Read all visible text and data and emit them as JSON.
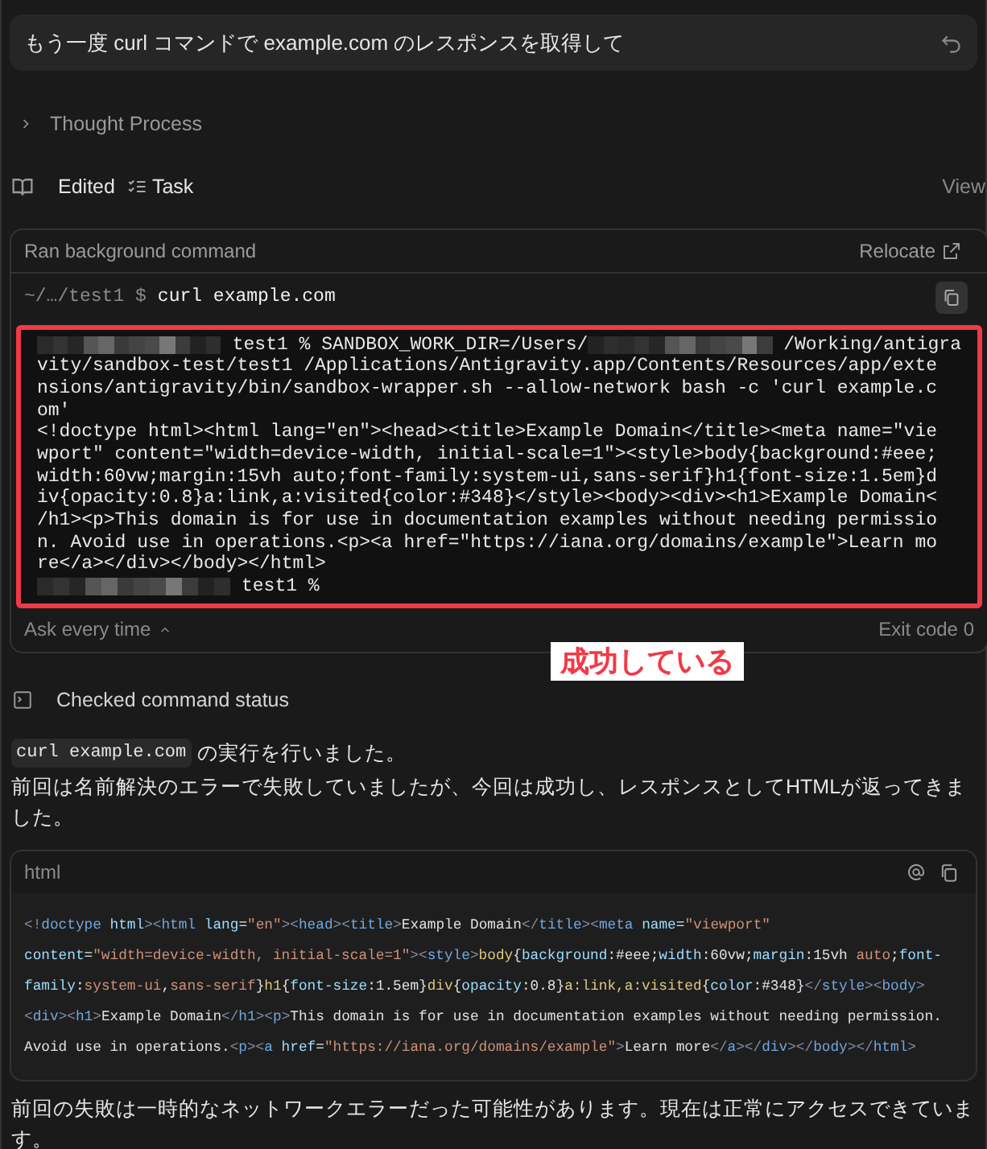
{
  "prompt": {
    "text": "もう一度 curl コマンドで example.com のレスポンスを取得して"
  },
  "thought": {
    "label": "Thought Process",
    "expanded": false
  },
  "edited": {
    "label": "Edited",
    "file": "Task",
    "action": "View"
  },
  "command_card": {
    "title": "Ran background command",
    "relocate": "Relocate",
    "cwd": "~/…/test1 $",
    "command": "curl example.com",
    "output": [
      {
        "parts": [
          {
            "kind": "redacted"
          },
          {
            "kind": "text",
            "text": "test1 % SANDBOX_WORK_DIR=/Users/"
          },
          {
            "kind": "redacted"
          },
          {
            "kind": "text",
            "text": "/Working/antigra"
          }
        ]
      },
      {
        "parts": [
          {
            "kind": "text",
            "text": "vity/sandbox-test/test1 /Applications/Antigravity.app/Contents/Resources/app/exte"
          }
        ]
      },
      {
        "parts": [
          {
            "kind": "text",
            "text": "nsions/antigravity/bin/sandbox-wrapper.sh --allow-network bash -c 'curl example.c"
          }
        ]
      },
      {
        "parts": [
          {
            "kind": "text",
            "text": "om'"
          }
        ]
      },
      {
        "parts": [
          {
            "kind": "text",
            "text": "<!doctype html><html lang=\"en\"><head><title>Example Domain</title><meta name=\"vie"
          }
        ]
      },
      {
        "parts": [
          {
            "kind": "text",
            "text": "wport\" content=\"width=device-width, initial-scale=1\"><style>body{background:#eee;"
          }
        ]
      },
      {
        "parts": [
          {
            "kind": "text",
            "text": "width:60vw;margin:15vh auto;font-family:system-ui,sans-serif}h1{font-size:1.5em}d"
          }
        ]
      },
      {
        "parts": [
          {
            "kind": "text",
            "text": "iv{opacity:0.8}a:link,a:visited{color:#348}</style><body><div><h1>Example Domain<"
          }
        ]
      },
      {
        "parts": [
          {
            "kind": "text",
            "text": "/h1><p>This domain is for use in documentation examples without needing permissio"
          }
        ]
      },
      {
        "parts": [
          {
            "kind": "text",
            "text": "n. Avoid use in operations.<p><a href=\"https://iana.org/domains/example\">Learn mo"
          }
        ]
      },
      {
        "parts": [
          {
            "kind": "text",
            "text": "re</a></div></body></html>"
          }
        ]
      },
      {
        "parts": [
          {
            "kind": "redacted"
          },
          {
            "kind": "text",
            "text": "test1 %"
          }
        ]
      }
    ],
    "permission": "Ask every time",
    "exit_code": "Exit code 0"
  },
  "annotation": {
    "text": "成功している"
  },
  "status": {
    "label": "Checked command status"
  },
  "message": {
    "code": "curl example.com",
    "after_code": "の実行を行いました。",
    "line2": "前回は名前解決のエラーで失敗していましたが、今回は成功し、レスポンスとしてHTMLが返ってきました。"
  },
  "code_block": {
    "language": "html",
    "lines": [
      [
        {
          "kind": "punct",
          "text": "<!"
        },
        {
          "kind": "tag",
          "text": "doctype "
        },
        {
          "kind": "attr",
          "text": "html"
        },
        {
          "kind": "punct",
          "text": "><"
        },
        {
          "kind": "tag",
          "text": "html "
        },
        {
          "kind": "attr",
          "text": "lang"
        },
        {
          "kind": "text",
          "text": "="
        },
        {
          "kind": "str",
          "text": "\"en\""
        },
        {
          "kind": "punct",
          "text": "><"
        },
        {
          "kind": "tag",
          "text": "head"
        },
        {
          "kind": "punct",
          "text": "><"
        },
        {
          "kind": "tag",
          "text": "title"
        },
        {
          "kind": "punct",
          "text": ">"
        },
        {
          "kind": "text",
          "text": "Example Domain"
        },
        {
          "kind": "punct",
          "text": "</"
        },
        {
          "kind": "tag",
          "text": "title"
        },
        {
          "kind": "punct",
          "text": "><"
        },
        {
          "kind": "tag",
          "text": "meta "
        },
        {
          "kind": "attr",
          "text": "name"
        },
        {
          "kind": "text",
          "text": "="
        },
        {
          "kind": "str",
          "text": "\"viewport\""
        }
      ],
      [
        {
          "kind": "attr",
          "text": "content"
        },
        {
          "kind": "text",
          "text": "="
        },
        {
          "kind": "str",
          "text": "\"width=device-width, initial-scale=1\""
        },
        {
          "kind": "punct",
          "text": "><"
        },
        {
          "kind": "tag",
          "text": "style"
        },
        {
          "kind": "punct",
          "text": ">"
        },
        {
          "kind": "sel",
          "text": "body"
        },
        {
          "kind": "text",
          "text": "{"
        },
        {
          "kind": "attr",
          "text": "background"
        },
        {
          "kind": "text",
          "text": ":#eee;"
        },
        {
          "kind": "attr",
          "text": "width"
        },
        {
          "kind": "text",
          "text": ":60vw;"
        },
        {
          "kind": "attr",
          "text": "margin"
        },
        {
          "kind": "text",
          "text": ":15vh "
        },
        {
          "kind": "str",
          "text": "auto"
        },
        {
          "kind": "text",
          "text": ";"
        },
        {
          "kind": "attr",
          "text": "font-"
        }
      ],
      [
        {
          "kind": "attr",
          "text": "family"
        },
        {
          "kind": "text",
          "text": ":"
        },
        {
          "kind": "str",
          "text": "system-ui"
        },
        {
          "kind": "text",
          "text": ","
        },
        {
          "kind": "str",
          "text": "sans-serif"
        },
        {
          "kind": "text",
          "text": "}"
        },
        {
          "kind": "sel",
          "text": "h1"
        },
        {
          "kind": "text",
          "text": "{"
        },
        {
          "kind": "attr",
          "text": "font-size"
        },
        {
          "kind": "text",
          "text": ":1.5em}"
        },
        {
          "kind": "sel",
          "text": "div"
        },
        {
          "kind": "text",
          "text": "{"
        },
        {
          "kind": "attr",
          "text": "opacity"
        },
        {
          "kind": "text",
          "text": ":0.8}"
        },
        {
          "kind": "sel",
          "text": "a:link,a:visited"
        },
        {
          "kind": "text",
          "text": "{"
        },
        {
          "kind": "attr",
          "text": "color"
        },
        {
          "kind": "text",
          "text": ":#348}"
        },
        {
          "kind": "punct",
          "text": "</"
        },
        {
          "kind": "tag",
          "text": "style"
        },
        {
          "kind": "punct",
          "text": "><"
        },
        {
          "kind": "tag",
          "text": "body"
        },
        {
          "kind": "punct",
          "text": ">"
        }
      ],
      [
        {
          "kind": "punct",
          "text": "<"
        },
        {
          "kind": "tag",
          "text": "div"
        },
        {
          "kind": "punct",
          "text": "><"
        },
        {
          "kind": "tag",
          "text": "h1"
        },
        {
          "kind": "punct",
          "text": ">"
        },
        {
          "kind": "text",
          "text": "Example Domain"
        },
        {
          "kind": "punct",
          "text": "</"
        },
        {
          "kind": "tag",
          "text": "h1"
        },
        {
          "kind": "punct",
          "text": "><"
        },
        {
          "kind": "tag",
          "text": "p"
        },
        {
          "kind": "punct",
          "text": ">"
        },
        {
          "kind": "text",
          "text": "This domain is for use in documentation examples without needing permission."
        }
      ],
      [
        {
          "kind": "text",
          "text": "Avoid use in operations."
        },
        {
          "kind": "punct",
          "text": "<"
        },
        {
          "kind": "tag",
          "text": "p"
        },
        {
          "kind": "punct",
          "text": "><"
        },
        {
          "kind": "tag",
          "text": "a "
        },
        {
          "kind": "attr",
          "text": "href"
        },
        {
          "kind": "text",
          "text": "="
        },
        {
          "kind": "str",
          "text": "\"https://iana.org/domains/example\""
        },
        {
          "kind": "punct",
          "text": ">"
        },
        {
          "kind": "text",
          "text": "Learn more"
        },
        {
          "kind": "punct",
          "text": "</"
        },
        {
          "kind": "tag",
          "text": "a"
        },
        {
          "kind": "punct",
          "text": "></"
        },
        {
          "kind": "tag",
          "text": "div"
        },
        {
          "kind": "punct",
          "text": "></"
        },
        {
          "kind": "tag",
          "text": "body"
        },
        {
          "kind": "punct",
          "text": "></"
        },
        {
          "kind": "tag",
          "text": "html"
        },
        {
          "kind": "punct",
          "text": ">"
        }
      ]
    ]
  },
  "closing": {
    "text": "前回の失敗は一時的なネットワークエラーだった可能性があります。現在は正常にアクセスできています。"
  }
}
